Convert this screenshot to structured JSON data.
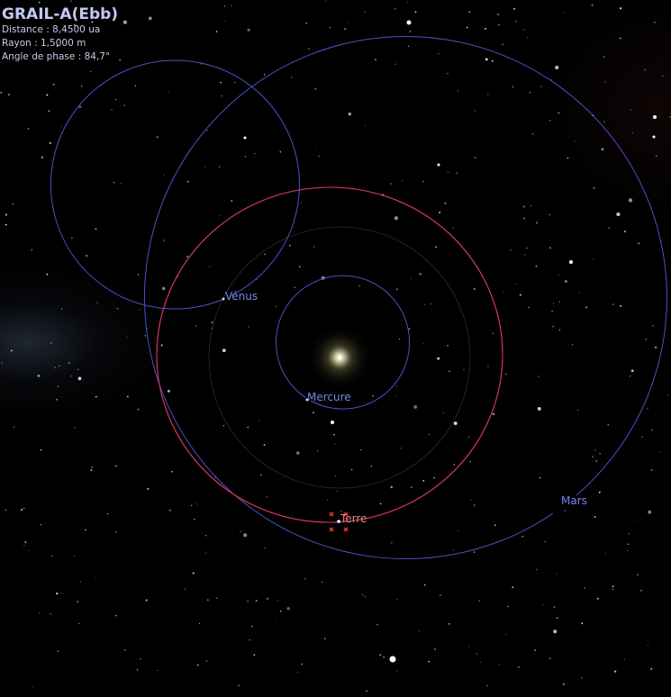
{
  "object_info": {
    "name": "GRAIL-A(Ebb)",
    "distance": "Distance : 8,4500 ua",
    "radius": "Rayon : 1,5000 m",
    "phase_angle": "Angle de phase : 84,7°"
  },
  "planet_labels": {
    "venus": "Vénus",
    "mercury": "Mercure",
    "earth": "Terre",
    "mars": "Mars"
  },
  "colors": {
    "orbit_planet": "#4a52c8",
    "orbit_selected": "#e0304a",
    "label_planet": "#7a83e8",
    "label_earth": "#e08a8a",
    "selection_marker": "#ff3a2a",
    "sun_glow": "#f3efc0"
  }
}
